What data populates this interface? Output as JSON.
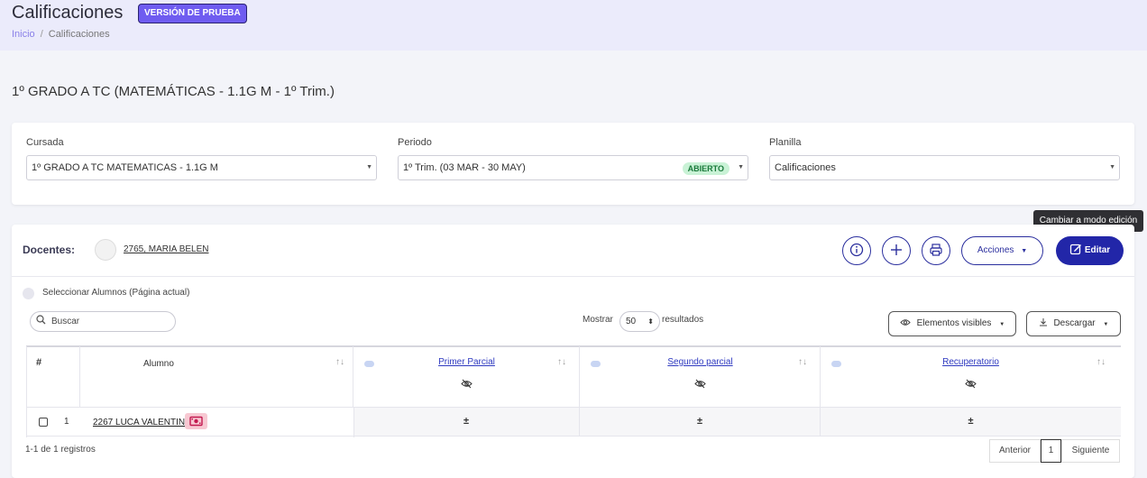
{
  "header": {
    "title": "Calificaciones",
    "trial_badge": "VERSIÓN DE PRUEBA",
    "breadcrumb": [
      "Inicio",
      "Calificaciones"
    ]
  },
  "subject_title": "1º GRADO A TC (MATEMÁTICAS - 1.1G M - 1º Trim.)",
  "filters": {
    "cursada": {
      "label": "Cursada",
      "value": "1º GRADO A TC MATEMATICAS - 1.1G M"
    },
    "periodo": {
      "label": "Periodo",
      "value": "1º Trim. (03 MAR - 30 MAY)",
      "status": "ABIERTO"
    },
    "planilla": {
      "label": "Planilla",
      "value": "Calificaciones"
    }
  },
  "tooltip": "Cambiar a modo edición",
  "toolbar": {
    "docentes_label": "Docentes:",
    "teacher_name": "2765, MARIA BELEN",
    "acciones_label": "Acciones",
    "editar_label": "Editar",
    "icons": [
      "info-icon",
      "plus-icon",
      "printer-icon",
      "edit-icon"
    ]
  },
  "select_all_label": "Seleccionar Alumnos (Página actual)",
  "search": {
    "placeholder": "Buscar"
  },
  "show": {
    "prefix": "Mostrar",
    "value": "50",
    "suffix": "resultados"
  },
  "buttons": {
    "visible_elements": "Elementos visibles",
    "download": "Descargar"
  },
  "table": {
    "headers": [
      "#",
      "Alumno",
      "Primer Parcial",
      "Segundo parcial",
      "Recuperatorio"
    ],
    "rows": [
      {
        "num": "1",
        "student": "2267 LUCA VALENTIN",
        "grades": [
          "±",
          "±",
          "±"
        ]
      }
    ]
  },
  "footer": {
    "records": "1-1 de 1 registros",
    "prev": "Anterior",
    "page": "1",
    "next": "Siguiente"
  },
  "colors": {
    "accent": "#2226a8",
    "trial_badge": "#6f5cf0",
    "status_open": "#c9f2d6"
  }
}
